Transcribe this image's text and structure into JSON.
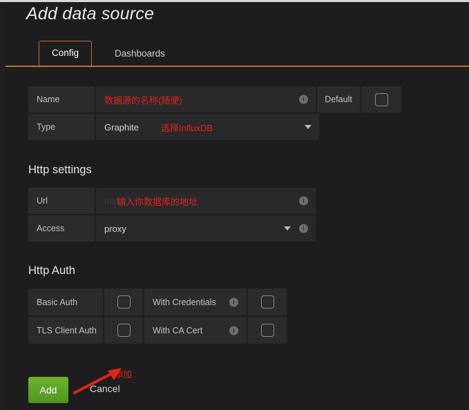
{
  "page": {
    "title": "Add data source",
    "accent_orange": "#bb7428",
    "annotation_red": "#e2231a",
    "add_button_green": "#5aa327",
    "background": "#1d1d1f"
  },
  "tabs": [
    {
      "label": "Config",
      "active": true
    },
    {
      "label": "Dashboards",
      "active": false
    }
  ],
  "config": {
    "name_row": {
      "label": "Name",
      "value": "",
      "annotation": "数据源的名称(随便)",
      "info_icon": "info-icon",
      "default_label": "Default",
      "default_checked": false
    },
    "type_row": {
      "label": "Type",
      "value": "Graphite",
      "annotation": "选择InfluxDB",
      "caret_icon": "chevron-down-icon"
    }
  },
  "http_settings": {
    "title": "Http settings",
    "url_row": {
      "label": "Url",
      "value": "",
      "placeholder": "http://",
      "annotation": "输入你数据库的地址",
      "info_icon": "info-icon"
    },
    "access_row": {
      "label": "Access",
      "value": "proxy",
      "caret_icon": "chevron-down-icon",
      "info_icon": "info-icon"
    }
  },
  "http_auth": {
    "title": "Http Auth",
    "rows": [
      {
        "left_label": "Basic Auth",
        "left_checked": false,
        "right_label": "With Credentials",
        "right_info_icon": "info-icon",
        "right_checked": false
      },
      {
        "left_label": "TLS Client Auth",
        "left_checked": false,
        "right_label": "With CA Cert",
        "right_info_icon": "info-icon",
        "right_checked": false
      }
    ]
  },
  "footer": {
    "add_label": "Add",
    "cancel_label": "Cancel",
    "add_annotation": "添加",
    "arrow_icon": "arrow-pointer-icon"
  },
  "icons": {
    "info": "i"
  }
}
